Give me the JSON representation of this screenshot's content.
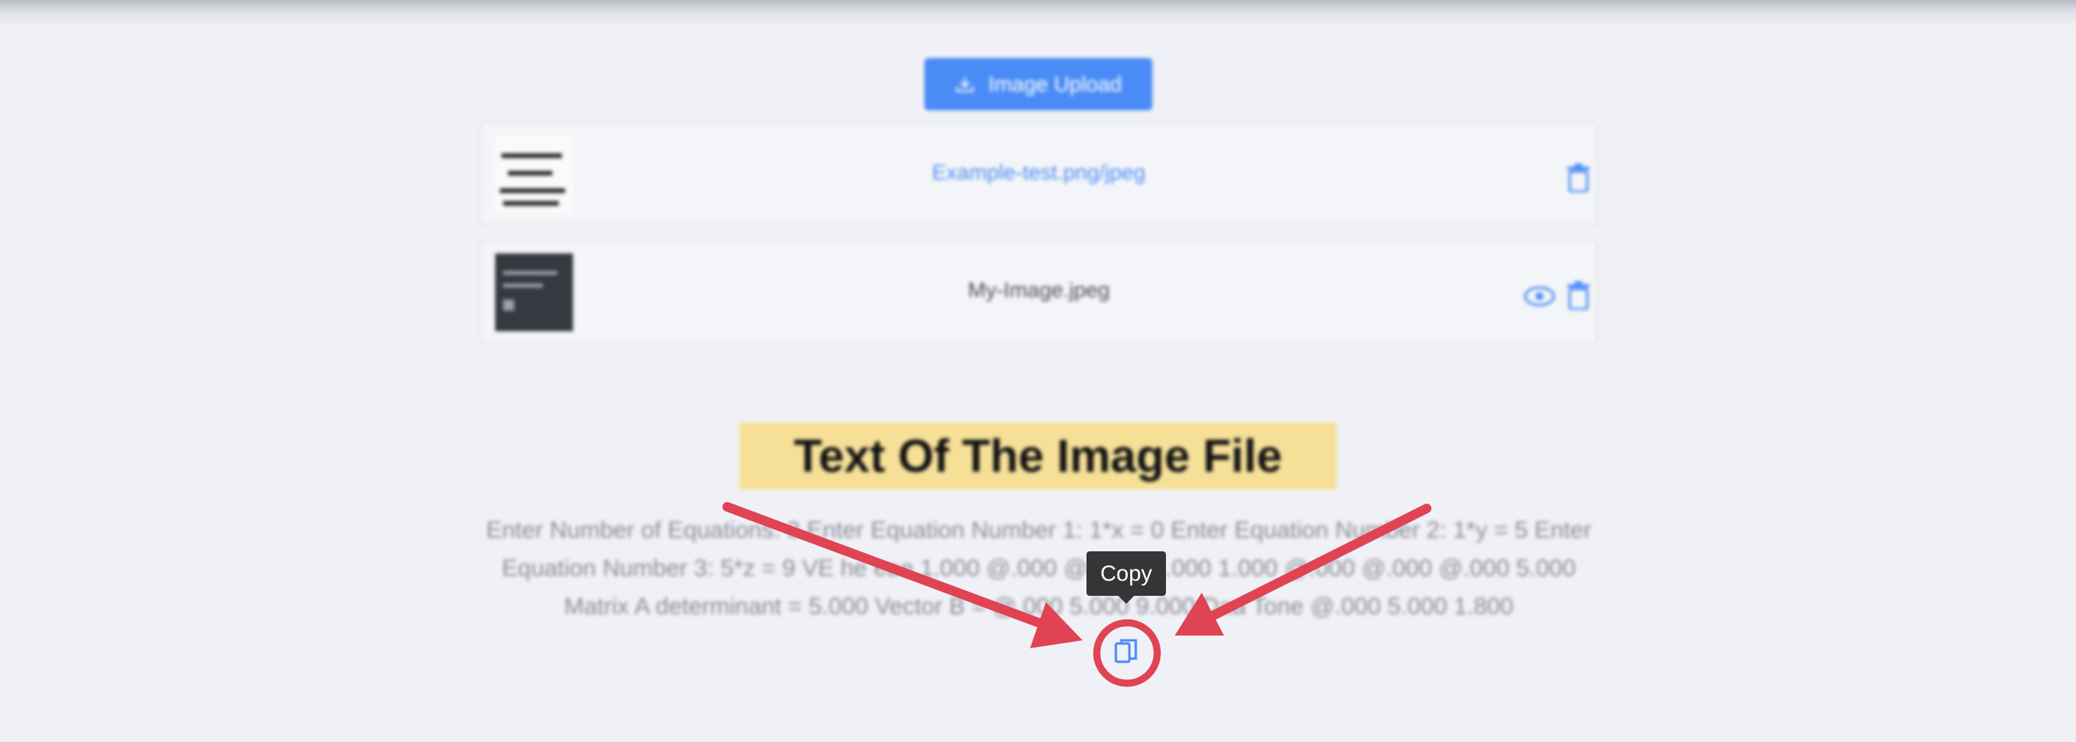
{
  "upload": {
    "label": "Image Upload"
  },
  "files": [
    {
      "name": "Example-test.png/jpeg",
      "thumbnail": "document-thumbnail"
    },
    {
      "name": "My-Image.jpeg",
      "thumbnail": "dark-screenshot-thumbnail"
    }
  ],
  "result": {
    "title": "Text Of The Image File",
    "text": "Enter Number of Equations: 3 Enter Equation Number 1: 1*x = 0 Enter Equation Number 2: 1*y = 5 Enter Equation Number 3: 5*z = 9 VE he eae 1.000 @.000 @.000 @.000 1.000 @.000 @.000 @.000 5.000 Matrix A determinant = 5.000 Vector B = @.000 5.000 9.000 Daa Tone @.000 5.000 1.800"
  },
  "copy": {
    "tooltip": "Copy",
    "icon": "copy-icon"
  },
  "colors": {
    "primary": "#4a8cf6",
    "highlight": "#f6e097",
    "annotation": "#e04353",
    "background": "#f0f1f6"
  }
}
